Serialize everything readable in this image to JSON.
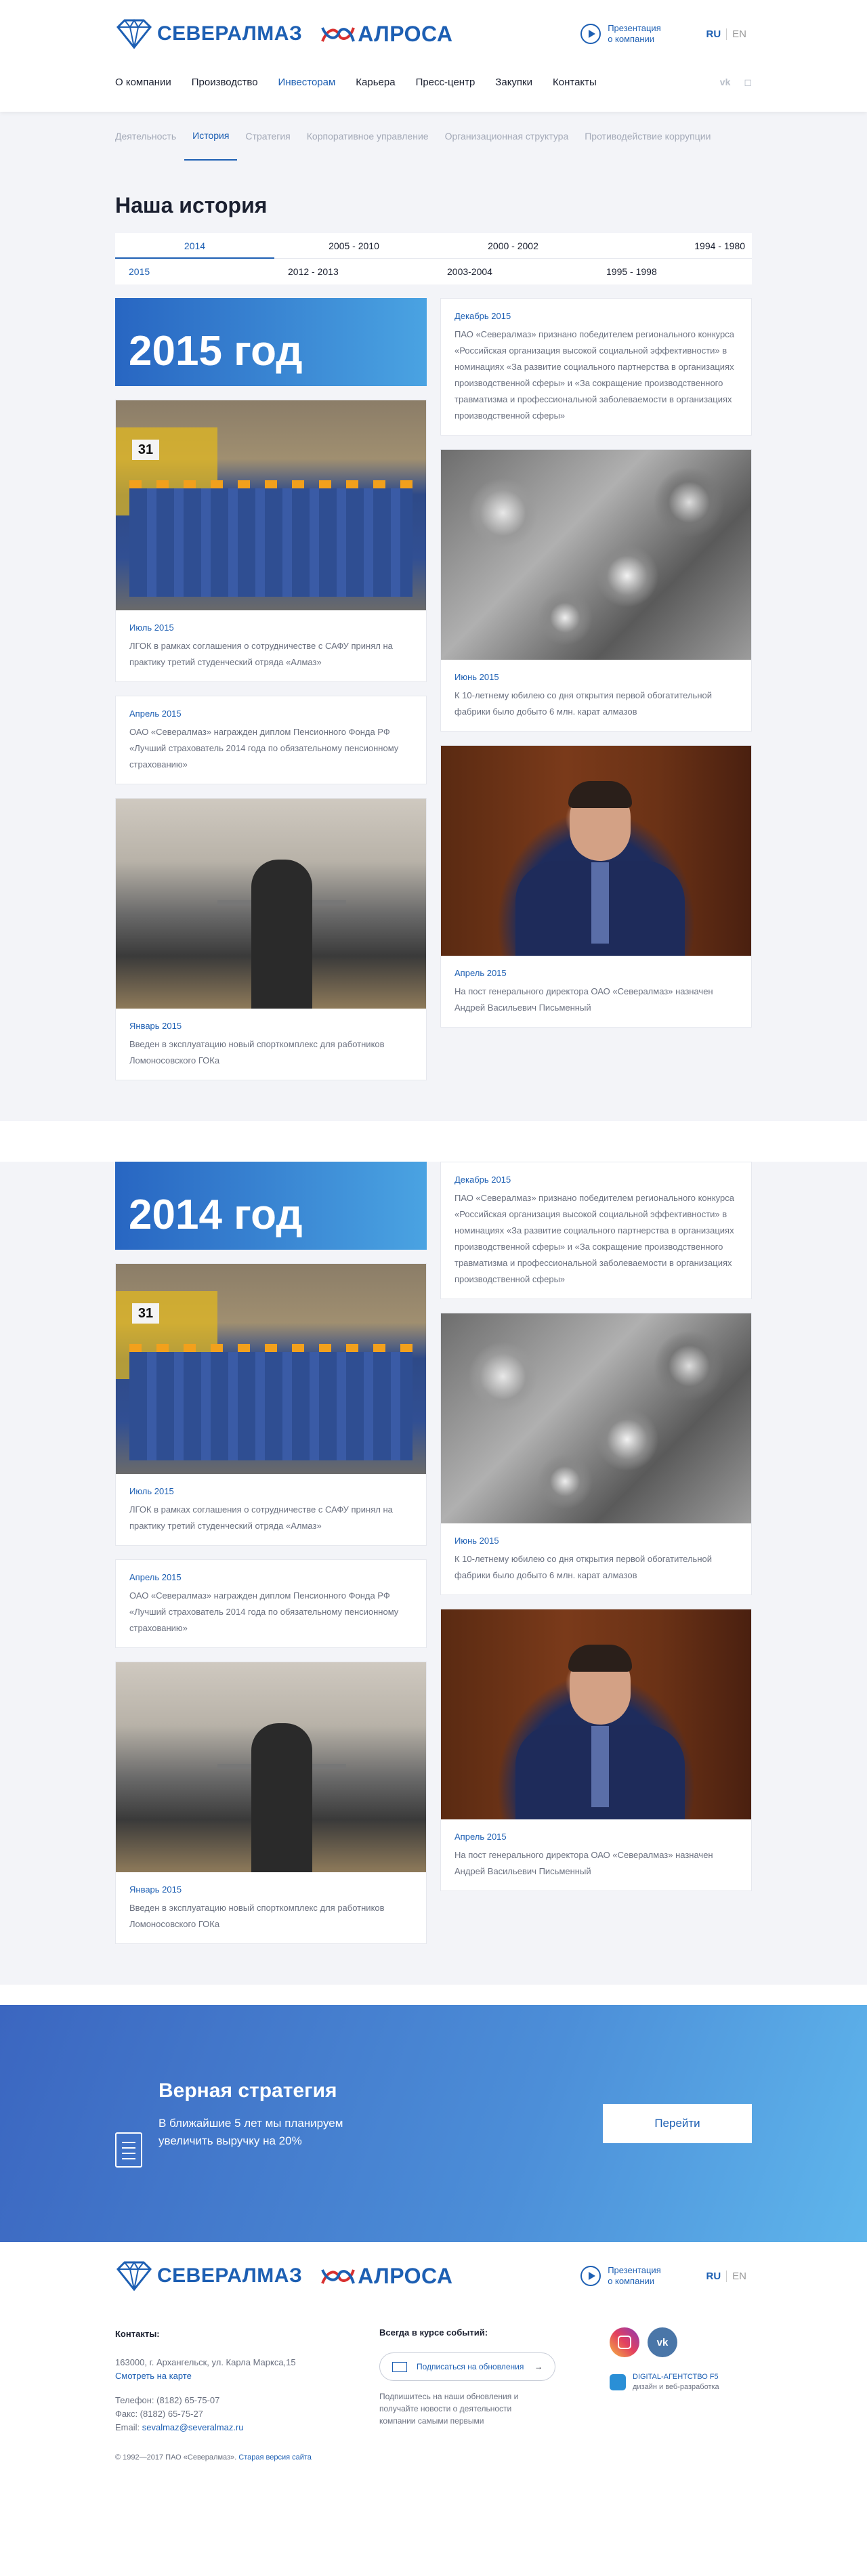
{
  "header": {
    "logo_severalmaz": "СЕВЕРАЛМАЗ",
    "logo_alrosa": "АЛРОСА",
    "presentation": [
      "Презентация",
      "о компании"
    ],
    "lang_ru": "RU",
    "lang_en": "EN",
    "nav": [
      "О компании",
      "Производство",
      "Инвесторам",
      "Карьера",
      "Пресс-центр",
      "Закупки",
      "Контакты"
    ],
    "nav_active": "Инвесторам",
    "social": [
      "vk-icon",
      "instagram-icon"
    ]
  },
  "subnav": [
    "Деятельность",
    "История",
    "Стратегия",
    "Корпоративное управление",
    "Организационная структура",
    "Противодействие коррупции"
  ],
  "subnav_active": "История",
  "page_title": "Наша история",
  "years_row1": [
    "2014",
    "2005 - 2010",
    "2000 - 2002",
    "1994 - 1980"
  ],
  "years_row2": [
    "2015",
    "2012 - 2013",
    "2003-2004",
    "1995 - 1998"
  ],
  "years_active": "2014",
  "sections": [
    {
      "banner": "2015 год",
      "left": [
        {
          "date": "Июль 2015",
          "text": "ЛГОК в рамках соглашения о сотрудничестве с САФУ принял на практику третий студенческий отряда «Алмаз»"
        },
        {
          "date": "Апрель 2015",
          "text": "ОАО «Севералмаз» награжден диплом Пенсионного Фонда РФ «Лучший страхователь 2014 года по обязательному пенсионному страхованию»"
        },
        {
          "date": "Январь 2015",
          "text": "Введен в эксплуатацию новый спорткомплекс для работников Ломоносовского ГОКа"
        }
      ],
      "right": [
        {
          "date": "Декабрь 2015",
          "text": "ПАО «Севералмаз» признано победителем регионального конкурса «Российская организация высокой социальной эффективности» в номинациях «За развитие социального партнерства в организациях производственной сферы» и «За сокращение производственного травматизма и профессиональной заболеваемости в организациях производственной сферы»"
        },
        {
          "date": "Июнь 2015",
          "text": "К 10-летнему юбилею со дня открытия первой обогатительной фабрики было добыто 6 млн. карат алмазов"
        },
        {
          "date": "Апрель 2015",
          "text": "На пост генерального директора ОАО «Севералмаз» назначен Андрей Васильевич Письменный"
        }
      ]
    },
    {
      "banner": "2014 год",
      "left": [
        {
          "date": "Июль 2015",
          "text": "ЛГОК в рамках соглашения о сотрудничестве с САФУ принял на практику третий студенческий отряда «Алмаз»"
        },
        {
          "date": "Апрель 2015",
          "text": "ОАО «Севералмаз» награжден диплом Пенсионного Фонда РФ «Лучший страхователь 2014 года по обязательному пенсионному страхованию»"
        },
        {
          "date": "Январь 2015",
          "text": "Введен в эксплуатацию новый спорткомплекс для работников Ломоносовского ГОКа"
        }
      ],
      "right": [
        {
          "date": "Декабрь 2015",
          "text": "ПАО «Севералмаз» признано победителем регионального конкурса «Российская организация высокой социальной эффективности» в номинациях «За развитие социального партнерства в организациях производственной сферы» и «За сокращение производственного травматизма и профессиональной заболеваемости в организациях производственной сферы»"
        },
        {
          "date": "Июнь 2015",
          "text": "К 10-летнему юбилею со дня открытия первой обогатительной фабрики было добыто 6 млн. карат алмазов"
        },
        {
          "date": "Апрель 2015",
          "text": "На пост генерального директора ОАО «Севералмаз» назначен Андрей Васильевич Письменный"
        }
      ]
    }
  ],
  "crew_sign": "31",
  "strategy": {
    "title": "Верная стратегия",
    "text": "В ближайшие 5 лет мы планируем увеличить выручку на 20%",
    "button": "Перейти"
  },
  "footer": {
    "contacts_title": "Контакты:",
    "address": "163000, г. Архангельск, ул. Карла Маркса,15",
    "map_link": "Смотреть на карте",
    "phone": "Телефон: (8182) 65-75-07",
    "fax": "Факс: (8182) 65-75-27",
    "email_label": "Email:",
    "email": "sevalmaz@severalmaz.ru",
    "subscribe_title": "Всегда в курсе событий:",
    "subscribe_button": "Подписаться на обновления",
    "subscribe_text": "Подпишитесь на наши обновления и получайте новости о деятельности компании самыми первыми",
    "agency_name": "DIGITAL-АГЕНТСТВО F5",
    "agency_desc": "дизайн и веб-разработка",
    "vk": "vk",
    "copyright": "© 1992—2017 ПАО «Севералмаз».",
    "old_site": "Старая версия сайта"
  },
  "colors": {
    "accent": "#1d5fb3",
    "gradient_start": "#2866c2",
    "gradient_end": "#4aa3e2",
    "page_gray": "#f3f4f8"
  }
}
